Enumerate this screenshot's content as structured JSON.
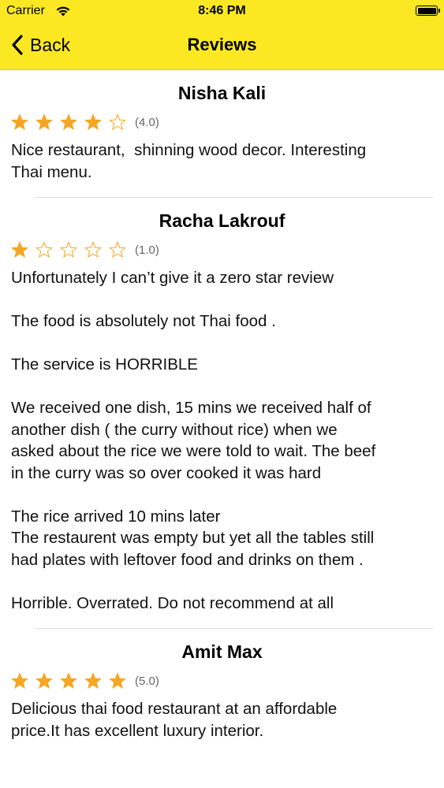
{
  "status_bar": {
    "carrier": "Carrier",
    "time": "8:46 PM"
  },
  "nav": {
    "back_label": "Back",
    "title": "Reviews"
  },
  "colors": {
    "nav_bg": "#fbe823",
    "star_filled": "#f5a623",
    "star_empty": "#f5a623"
  },
  "reviews": [
    {
      "name": "Nisha Kali",
      "stars": 4,
      "rating_text": "(4.0)",
      "text": "Nice restaurant,  shinning wood decor. Interesting\nThai menu."
    },
    {
      "name": "Racha Lakrouf",
      "stars": 1,
      "rating_text": "(1.0)",
      "text": "Unfortunately I can’t give it a zero star review\n\nThe food is absolutely not Thai food .\n\nThe service is HORRIBLE\n\nWe received one dish, 15 mins we received half of\nanother dish ( the curry without rice) when we\nasked about the rice we were told to wait. The beef\nin the curry was so over cooked it was hard\n\nThe rice arrived 10 mins later\nThe restaurent was empty but yet all the tables still\nhad plates with leftover food and drinks on them .\n\nHorrible. Overrated. Do not recommend at all"
    },
    {
      "name": "Amit Max",
      "stars": 5,
      "rating_text": "(5.0)",
      "text": "Delicious thai food restaurant at an affordable\nprice.It has excellent luxury interior."
    }
  ]
}
